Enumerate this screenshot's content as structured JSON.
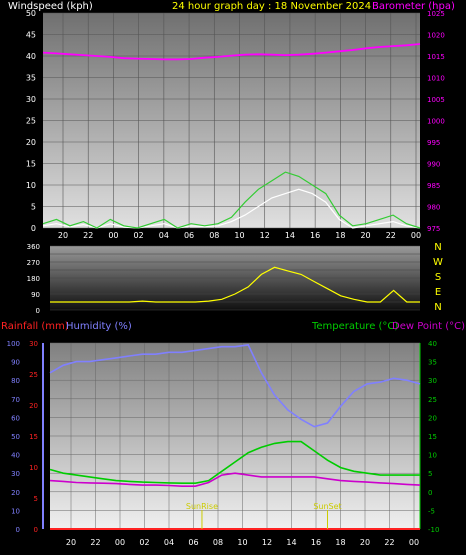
{
  "header": {
    "left_title": "Windspeed (kph)",
    "center_title": "24 hour graph day : 18 November 2024",
    "right_title": "Barometer (hpa)"
  },
  "colors": {
    "wind_avg": "#ffffff",
    "wind_gust": "#33cc33",
    "barometer": "#ff00ff",
    "direction": "#ffff00",
    "rainfall": "#ff2222",
    "humidity": "#8080ff",
    "temperature": "#00cc00",
    "dewpoint": "#cc00cc",
    "sun": "#cccc00"
  },
  "chart_data": [
    {
      "type": "line",
      "name": "wind-barometer",
      "x_ticks": [
        "20",
        "22",
        "00",
        "02",
        "04",
        "06",
        "08",
        "10",
        "12",
        "14",
        "16",
        "18",
        "20",
        "22",
        "00"
      ],
      "ylabel": "Windspeed (kph)",
      "ylim": [
        0,
        50
      ],
      "y_ticks": [
        "0",
        "5",
        "10",
        "15",
        "20",
        "25",
        "30",
        "35",
        "40",
        "45",
        "50"
      ],
      "y2label": "Barometer (hpa)",
      "y2lim": [
        975,
        1025
      ],
      "y2_ticks": [
        "975",
        "980",
        "985",
        "990",
        "995",
        "1000",
        "1005",
        "1010",
        "1015",
        "1020",
        "1025"
      ],
      "x_hours": [
        0,
        1,
        2,
        3,
        4,
        5,
        6,
        7,
        8,
        9,
        10,
        11,
        12,
        13,
        14,
        15,
        16,
        17,
        18,
        19,
        20,
        21,
        22,
        23,
        24,
        25,
        26,
        27,
        28
      ],
      "series": [
        {
          "key": "barometer",
          "axis": "right",
          "values": [
            1015.8,
            1015.6,
            1015.4,
            1015.2,
            1015.0,
            1014.8,
            1014.5,
            1014.4,
            1014.3,
            1014.2,
            1014.2,
            1014.3,
            1014.6,
            1014.8,
            1015.1,
            1015.3,
            1015.4,
            1015.3,
            1015.2,
            1015.3,
            1015.5,
            1015.8,
            1016.1,
            1016.4,
            1016.8,
            1017.1,
            1017.3,
            1017.5,
            1017.8
          ]
        },
        {
          "key": "wind_avg",
          "axis": "left",
          "values": [
            0.5,
            1,
            0.3,
            0.8,
            0,
            1,
            0.2,
            0,
            0.5,
            1,
            0,
            0.5,
            0.3,
            0.5,
            1.5,
            3,
            5,
            7,
            8,
            9,
            8,
            6,
            2,
            0,
            0.5,
            1,
            1.5,
            0.5,
            0
          ]
        },
        {
          "key": "wind_gust",
          "axis": "left",
          "values": [
            1,
            2,
            0.5,
            1.5,
            0,
            2,
            0.5,
            0,
            1,
            2,
            0,
            1,
            0.5,
            1,
            2.5,
            6,
            9,
            11,
            13,
            12,
            10,
            8,
            3,
            0.5,
            1,
            2,
            3,
            1,
            0
          ]
        }
      ]
    },
    {
      "type": "line",
      "name": "wind-direction",
      "ylim": [
        0,
        360
      ],
      "y_ticks": [
        "0",
        "45",
        "90",
        "135",
        "180",
        "225",
        "270",
        "315",
        "360"
      ],
      "compass": [
        "N",
        "W",
        "S",
        "E",
        "N"
      ],
      "x_hours": [
        0,
        1,
        2,
        3,
        4,
        5,
        6,
        7,
        8,
        9,
        10,
        11,
        12,
        13,
        14,
        15,
        16,
        17,
        18,
        19,
        20,
        21,
        22,
        23,
        24,
        25,
        26,
        27,
        28
      ],
      "series": [
        {
          "key": "direction",
          "axis": "left",
          "values": [
            45,
            45,
            45,
            45,
            45,
            45,
            45,
            50,
            45,
            45,
            45,
            45,
            50,
            60,
            90,
            130,
            200,
            240,
            220,
            200,
            160,
            120,
            80,
            60,
            45,
            45,
            110,
            45,
            45
          ]
        }
      ]
    },
    {
      "type": "line",
      "name": "temperature-humidity-rain",
      "x_ticks": [
        "20",
        "22",
        "00",
        "02",
        "04",
        "06",
        "08",
        "10",
        "12",
        "14",
        "16",
        "18",
        "20",
        "22",
        "00"
      ],
      "left_labels": [
        "Rainfall (mm)",
        "Humidity (%)"
      ],
      "right_labels": [
        "Temperature (°C)",
        "Dew Point (°C)"
      ],
      "rain_ylim": [
        0,
        30
      ],
      "rain_ticks": [
        "0",
        "5",
        "10",
        "15",
        "20",
        "25",
        "30"
      ],
      "humidity_ylim": [
        0,
        100
      ],
      "humidity_ticks": [
        "0",
        "10",
        "20",
        "30",
        "40",
        "50",
        "60",
        "70",
        "80",
        "90",
        "100"
      ],
      "temp_ylim": [
        -10,
        40
      ],
      "temp_ticks": [
        "-10",
        "-5",
        "0",
        "5",
        "10",
        "15",
        "20",
        "25",
        "30",
        "35",
        "40"
      ],
      "annotations": [
        {
          "label": "SunRise",
          "hour": 11.5
        },
        {
          "label": "SunSet",
          "hour": 21
        }
      ],
      "x_hours": [
        0,
        1,
        2,
        3,
        4,
        5,
        6,
        7,
        8,
        9,
        10,
        11,
        12,
        13,
        14,
        15,
        16,
        17,
        18,
        19,
        20,
        21,
        22,
        23,
        24,
        25,
        26,
        27,
        28
      ],
      "series": [
        {
          "key": "humidity",
          "axis": "humidity",
          "values": [
            84,
            88,
            90,
            90,
            91,
            92,
            93,
            94,
            94,
            95,
            95,
            96,
            97,
            98,
            98,
            99,
            84,
            72,
            64,
            59,
            55,
            57,
            66,
            74,
            78,
            79,
            81,
            80,
            78
          ]
        },
        {
          "key": "temperature",
          "axis": "temp",
          "values": [
            6,
            5,
            4.5,
            4,
            3.5,
            3,
            2.8,
            2.6,
            2.5,
            2.4,
            2.3,
            2.3,
            3,
            5.5,
            8,
            10.5,
            12,
            13,
            13.5,
            13.5,
            11,
            8.5,
            6.5,
            5.5,
            5,
            4.5,
            4.5,
            4.5,
            4.5
          ]
        },
        {
          "key": "dewpoint",
          "axis": "temp",
          "values": [
            3,
            2.8,
            2.5,
            2.4,
            2.3,
            2.2,
            2,
            1.8,
            1.8,
            1.7,
            1.5,
            1.5,
            2.5,
            4.5,
            5,
            4.5,
            4,
            4,
            4,
            4,
            4,
            3.5,
            3,
            2.8,
            2.6,
            2.4,
            2.2,
            2,
            1.8
          ]
        },
        {
          "key": "rainfall",
          "axis": "rain",
          "values": [
            0,
            0,
            0,
            0,
            0,
            0,
            0,
            0,
            0,
            0,
            0,
            0,
            0,
            0,
            0,
            0,
            0,
            0,
            0,
            0,
            0,
            0,
            0,
            0,
            0,
            0,
            0,
            0,
            0
          ]
        }
      ]
    }
  ]
}
